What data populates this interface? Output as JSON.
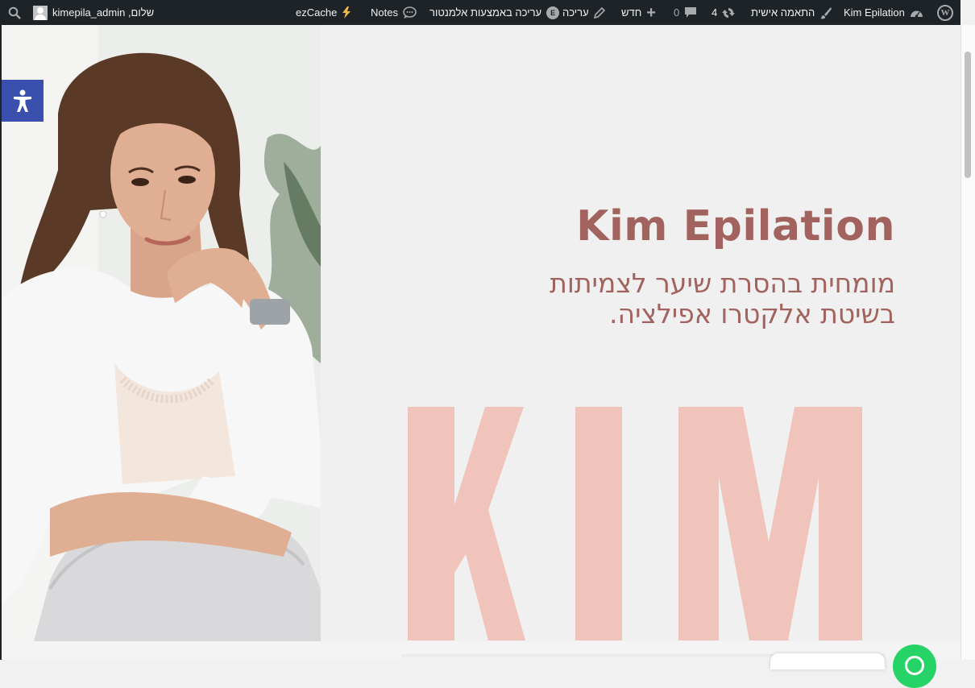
{
  "admin_bar": {
    "site_name": "Kim Epilation",
    "customize": "התאמה אישית",
    "updates_count": "4",
    "comments_count": "0",
    "new_label": "חדש",
    "edit_label": "עריכה",
    "elementor_edit_label": "עריכה באמצעות אלמנטור",
    "notes_label": "Notes",
    "ezcache_label": "ezCache",
    "greeting": "שלום, kimepila_admin"
  },
  "hero": {
    "title": "Kim Epilation",
    "subtitle": "מומחית בהסרת שיער לצמיתות בשיטת אלקטרו אפילציה.",
    "big_letters": [
      "K",
      "I",
      "M"
    ],
    "title_color": "#a2625d",
    "letters_color": "#f0c4bb"
  },
  "icons": {
    "wordpress": "wordpress-icon",
    "dashboard": "dashboard-icon",
    "brush": "brush-icon",
    "updates": "refresh-icon",
    "comments": "comment-icon",
    "new": "plus-icon",
    "edit": "pencil-icon",
    "elementor": "elementor-icon",
    "notes": "speech-bubble-icon",
    "ezcache": "lightning-icon",
    "user": "avatar",
    "search": "search-icon",
    "accessibility": "accessibility-icon",
    "whatsapp": "whatsapp-icon"
  }
}
